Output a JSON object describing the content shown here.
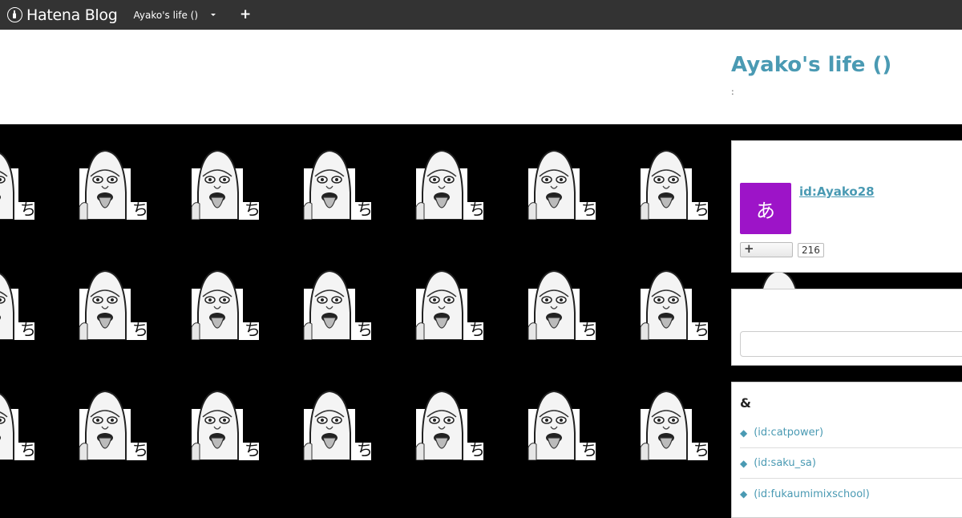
{
  "topbar": {
    "logo_text": "Hatena Blog",
    "blog_select_label": "Ayako's life ()",
    "plus_label": "+"
  },
  "header": {
    "title": "Ayako's life ()",
    "description": ":"
  },
  "profile": {
    "avatar_char": "あ",
    "avatar_color": "#9d14c8",
    "id_label": "id:Ayako28",
    "subscribe_icon": "+",
    "subscriber_count": "216"
  },
  "search": {
    "value": "",
    "placeholder": ""
  },
  "links": {
    "title": "&",
    "items": [
      {
        "label": "(id:catpower)",
        "bullet": "◆"
      },
      {
        "label": "(id:saku_sa)",
        "bullet": "◆"
      },
      {
        "label": "(id:fukaumimixschool)",
        "bullet": "◆"
      }
    ]
  },
  "colors": {
    "topbar_bg": "#333333",
    "accent": "#4a9ab3",
    "wallpaper_bg": "#000000"
  }
}
